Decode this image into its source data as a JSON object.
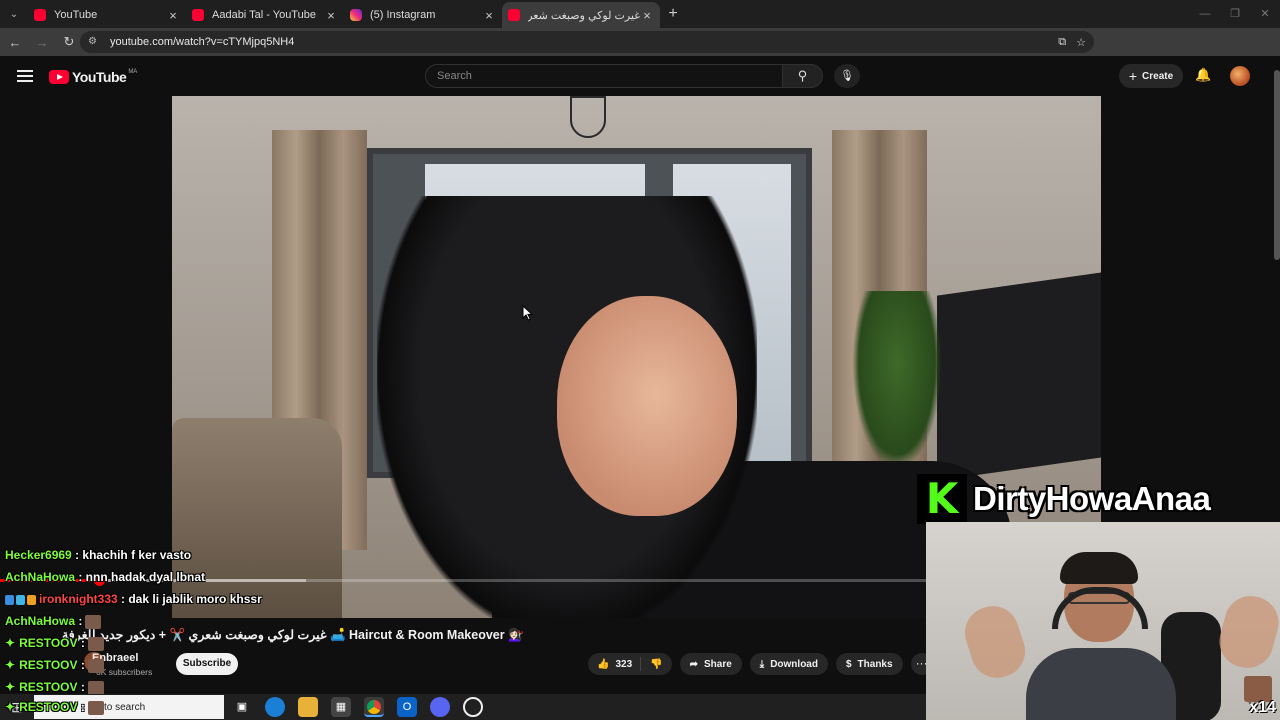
{
  "browser": {
    "tabs": [
      {
        "title": "YouTube",
        "favicon": "youtube-icon",
        "active": false
      },
      {
        "title": "Aadabi Tal - YouTube",
        "favicon": "youtube-icon",
        "active": false
      },
      {
        "title": "(5) Instagram",
        "favicon": "instagram-icon",
        "active": false
      },
      {
        "title": "غيرت لوكي وصبغت شعري ✂️",
        "favicon": "youtube-icon",
        "active": true
      }
    ],
    "new_tab": "+",
    "url": "youtube.com/watch?v=cTYMjpq5NH4"
  },
  "youtube": {
    "logo_text": "YouTube",
    "country_code": "MA",
    "search_placeholder": "Search",
    "create_label": "Create"
  },
  "video": {
    "progress_fraction": 0.107,
    "buffered_fraction": 0.33,
    "title": "غيرت لوكي وصبغت شعري ✂️ + ديكور جديد للغرفة 🛋️ Haircut & Room Makeover 💇🏻‍♀️",
    "channel": {
      "name": "Enbraeel",
      "subscribers": "6K subscribers"
    },
    "subscribe_label": "Subscribe",
    "likes": "323",
    "share_label": "Share",
    "download_label": "Download",
    "thanks_label": "Thanks",
    "more_label": "···"
  },
  "stream_overlay": {
    "chat": [
      {
        "user": "Hecker6969",
        "message": " : khachih f ker vasto",
        "color": "#7cfc3a"
      },
      {
        "user": "AchNaHowa",
        "message": " : nnn hadak dyal lbnat",
        "color": "#7cfc3a"
      },
      {
        "user": "ironknight333",
        "message": " : dak li jablik moro khssr",
        "color": "#ff4646"
      },
      {
        "user": "AchNaHowa",
        "message": " :",
        "color": "#7cfc3a"
      },
      {
        "user": "RESTOOV",
        "message": " :",
        "color": "#7cfc3a"
      },
      {
        "user": "RESTOOV",
        "message": " :",
        "color": "#7cfc3a"
      },
      {
        "user": "RESTOOV",
        "message": " :",
        "color": "#7cfc3a"
      },
      {
        "user": "RESTOOV",
        "message": " :",
        "color": "#7cfc3a"
      }
    ],
    "kick_letter": "K",
    "streamer_name": "DirtyHowaAnaa",
    "multiplier": "x14"
  },
  "taskbar": {
    "search_text": "to search"
  },
  "colors": {
    "accent": "#ff0033",
    "kick_green": "#53fc18",
    "background": "#0f0f0f"
  }
}
